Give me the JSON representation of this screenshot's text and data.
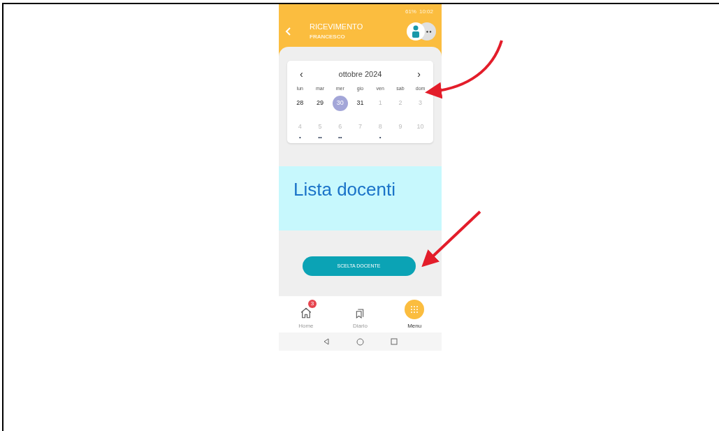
{
  "status_bar": {
    "battery": "61%",
    "time": "10:02"
  },
  "header": {
    "title": "RICEVIMENTO",
    "subtitle": "FRANCESCO"
  },
  "calendar": {
    "previous": "‹",
    "month": "ottobre 2024",
    "next": "›",
    "weekdays": [
      "lun",
      "mar",
      "mer",
      "gio",
      "ven",
      "sab",
      "dom"
    ],
    "weeks": [
      [
        {
          "label": "28",
          "muted": false,
          "selected": false
        },
        {
          "label": "29",
          "muted": false,
          "selected": false
        },
        {
          "label": "30",
          "muted": false,
          "selected": true
        },
        {
          "label": "31",
          "muted": false,
          "selected": false
        },
        {
          "label": "1",
          "muted": true,
          "selected": false
        },
        {
          "label": "2",
          "muted": true,
          "selected": false
        },
        {
          "label": "3",
          "muted": true,
          "selected": false
        }
      ],
      [
        {
          "label": "4",
          "muted": true,
          "selected": false,
          "dots": "•"
        },
        {
          "label": "5",
          "muted": true,
          "selected": false,
          "dots": "••"
        },
        {
          "label": "6",
          "muted": true,
          "selected": false,
          "dots": "••"
        },
        {
          "label": "7",
          "muted": true,
          "selected": false
        },
        {
          "label": "8",
          "muted": true,
          "selected": false,
          "dots": "•"
        },
        {
          "label": "9",
          "muted": true,
          "selected": false
        },
        {
          "label": "10",
          "muted": true,
          "selected": false
        }
      ]
    ]
  },
  "panel": {
    "title": "Lista docenti"
  },
  "button": {
    "label": "SCELTA DOCENTE"
  },
  "bottom_nav": [
    {
      "label": "Home",
      "kind": "home",
      "selected": false,
      "badge": "3"
    },
    {
      "label": "Diario",
      "kind": "diary",
      "selected": false
    },
    {
      "label": "Menu",
      "kind": "menu",
      "selected": true
    }
  ]
}
